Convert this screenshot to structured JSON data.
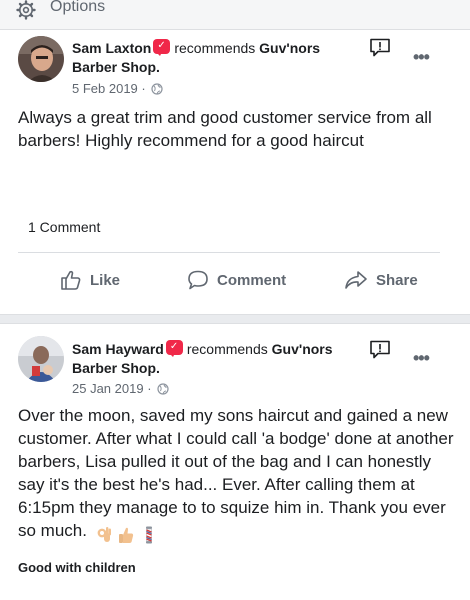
{
  "topbar": {
    "options_label": "Options",
    "icon": "gear-icon"
  },
  "posts": [
    {
      "author": "Sam Laxton",
      "recommends_text": "recommends",
      "page_name": "Guv'nors Barber Shop.",
      "date": "5 Feb 2019",
      "separator": "·",
      "body": "Always a great trim and good customer service from all barbers! Highly recommend for a good haircut",
      "comment_count": "1 Comment",
      "actions": {
        "like": "Like",
        "comment": "Comment",
        "share": "Share"
      }
    },
    {
      "author": "Sam Hayward",
      "recommends_text": "recommends",
      "page_name": "Guv'nors Barber Shop.",
      "date": "25 Jan 2019",
      "separator": "·",
      "body": "Over the moon, saved my sons haircut and gained a new customer. After what I could call 'a bodge' done at another barbers, Lisa pulled it out of the bag and I can honestly say it's the best he's had... Ever. After calling them at 6:15pm they manage to to squize him in. Thank you ever so much.",
      "tag": "Good with children"
    }
  ],
  "colors": {
    "recommend_badge": "#f02849",
    "muted": "#606770",
    "text": "#1c1e21",
    "band": "#e9ebee"
  }
}
